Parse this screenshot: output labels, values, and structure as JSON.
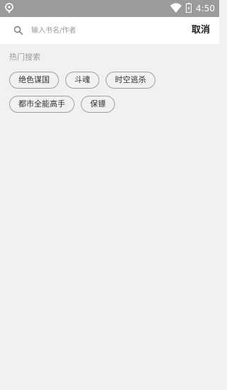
{
  "status_bar": {
    "time": "4:50",
    "icons": [
      "location-pin-icon",
      "wifi-icon",
      "battery-icon"
    ]
  },
  "search": {
    "placeholder": "输入书名/作者",
    "value": "",
    "cancel_label": "取消",
    "icon": "search-icon"
  },
  "hot_search": {
    "title": "热门搜索",
    "tags": [
      {
        "label": "绝色谋国"
      },
      {
        "label": "斗魂"
      },
      {
        "label": "时空逃杀"
      },
      {
        "label": "都市全能高手"
      },
      {
        "label": "保镖"
      }
    ]
  },
  "colors": {
    "status_bar_bg": "#9b9b9b",
    "page_bg": "#f1f1f1",
    "search_bg": "#ffffff",
    "chip_border": "#a0a0a0"
  }
}
